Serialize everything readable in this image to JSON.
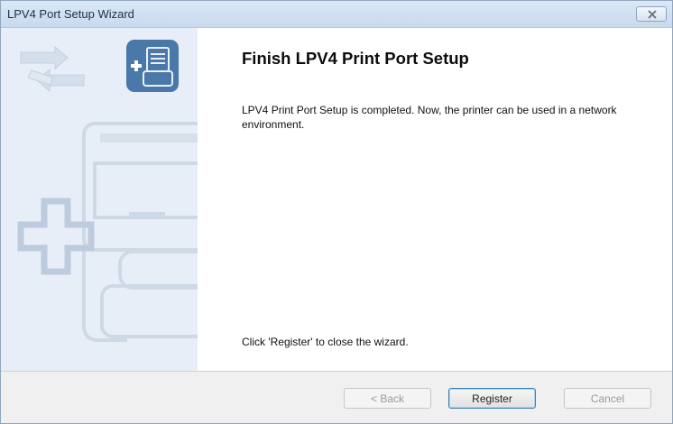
{
  "window": {
    "title": "LPV4 Port Setup Wizard"
  },
  "main": {
    "heading": "Finish LPV4 Print Port Setup",
    "description": "LPV4 Print Port Setup is completed. Now, the printer can be used in a network environment.",
    "footer_note": "Click 'Register' to close the wizard."
  },
  "buttons": {
    "back": "< Back",
    "register": "Register",
    "cancel": "Cancel"
  }
}
